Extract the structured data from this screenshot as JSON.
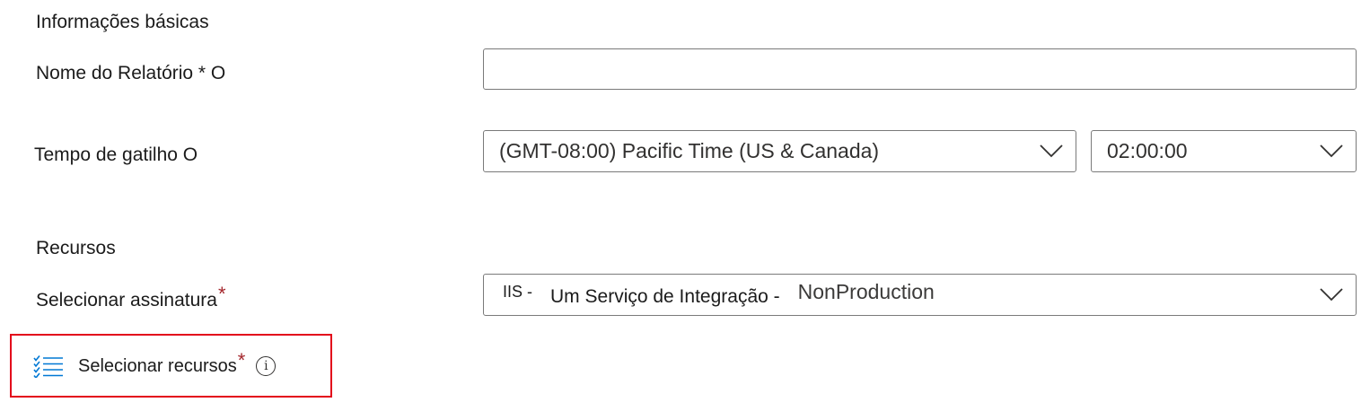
{
  "basic_info": {
    "section_title": "Informações básicas",
    "report_name_label": "Nome do Relatório * O",
    "report_name_value": "",
    "trigger_time_label": "Tempo de gatilho O",
    "timezone_value": "(GMT-08:00) Pacific Time (US & Canada)",
    "time_value": "02:00:00"
  },
  "resources": {
    "section_title": "Recursos",
    "subscription_label": "Selecionar assinatura",
    "required_marker": "*",
    "subscription_prefix": "IIS -",
    "subscription_middle": "Um Serviço de Integração -",
    "subscription_value": "NonProduction",
    "select_resources_label": "Selecionar recursos",
    "info_glyph": "i"
  },
  "icons": {
    "chevron": "chevron-down-icon",
    "list": "checklist-icon",
    "info": "info-icon"
  },
  "colors": {
    "accent_blue": "#0078d4",
    "required_red": "#a4262c",
    "highlight_red": "#e3051b",
    "border_gray": "#7a7a7a"
  }
}
